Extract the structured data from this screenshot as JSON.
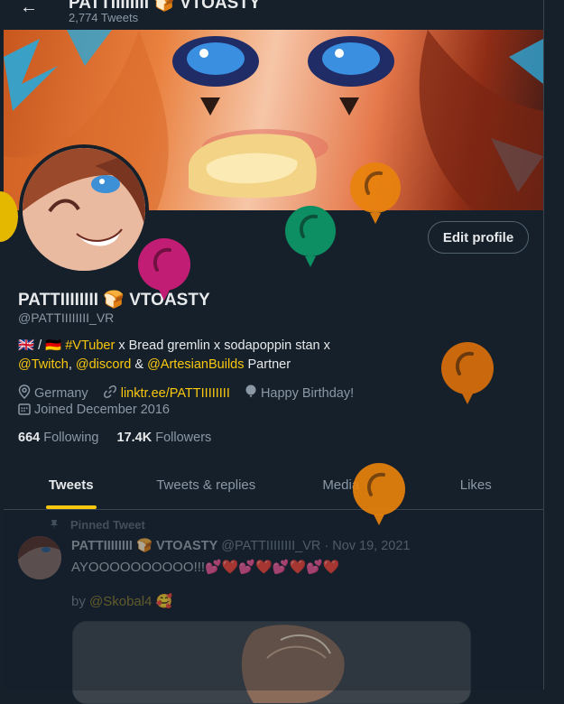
{
  "header": {
    "back_label": "←",
    "title": "PATTIIIIIIII 🍞 VTOASTY",
    "tweet_count": "2,774 Tweets"
  },
  "profile": {
    "edit_button": "Edit profile",
    "display_name": "PATTIIIIIIII 🍞 VTOASTY",
    "handle": "@PATTIIIIIIII_VR",
    "bio": {
      "flags": "🇬🇧 / 🇩🇪",
      "tag": "#VTuber",
      "text1": " x Bread gremlin x sodapoppin stan x",
      "twitch": "@Twitch",
      "sep1": ", ",
      "discord": "@discord",
      "sep2": " & ",
      "artesian": "@ArtesianBuilds",
      "text2": " Partner"
    },
    "location": "Germany",
    "website": "linktr.ee/PATTIIIIIIII",
    "birthday": "Happy Birthday!",
    "joined": "Joined December 2016",
    "following_count": "664",
    "following_label": "Following",
    "followers_count": "17.4K",
    "followers_label": "Followers"
  },
  "tabs": [
    "Tweets",
    "Tweets & replies",
    "Media",
    "Likes"
  ],
  "pinned_tweet": {
    "pinned_label": "Pinned Tweet",
    "author": "PATTIIIIIIII 🍞 VTOASTY",
    "handle_date": "@PATTIIIIIIII_VR · Nov 19, 2021",
    "text": "AYOOOOOOOOOO!!!💕❤️💕❤️💕❤️💕❤️",
    "by_label": "by ",
    "by_user": "@Skobal4",
    "by_emoji": "🥰"
  },
  "colors": {
    "accent": "#f9c80e",
    "background": "#15202b",
    "balloon_orange": "#e8820c",
    "balloon_green": "#0d8f63",
    "balloon_pink": "#c21d74"
  },
  "icons": [
    "back-arrow-icon",
    "location-icon",
    "link-icon",
    "balloon-icon",
    "calendar-icon",
    "pin-icon"
  ]
}
